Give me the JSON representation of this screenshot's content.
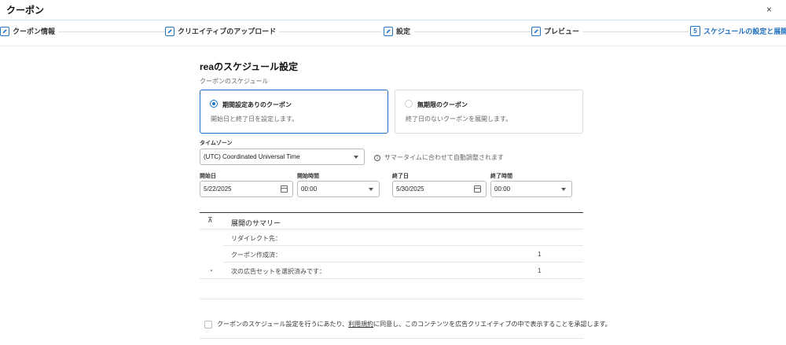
{
  "window": {
    "title": "クーポン",
    "close": "×"
  },
  "steps": [
    {
      "label": "クーポン情報",
      "state": "done"
    },
    {
      "label": "クリエイティブのアップロード",
      "state": "done"
    },
    {
      "label": "設定",
      "state": "done"
    },
    {
      "label": "プレビュー",
      "state": "done"
    },
    {
      "number": "5",
      "label": "スケジュールの設定と展開",
      "state": "active"
    }
  ],
  "main": {
    "heading": "reaのスケジュール設定",
    "subheading": "クーポンのスケジュール",
    "options": [
      {
        "title": "期間設定ありのクーポン",
        "description": "開始日と終了日を設定します。",
        "selected": true
      },
      {
        "title": "無期限のクーポン",
        "description": "終了日のないクーポンを展開します。",
        "selected": false
      }
    ],
    "timezone": {
      "label": "タイムゾーン",
      "value": "(UTC) Coordinated Universal Time",
      "note": "サマータイムに合わせて自動調整されます"
    },
    "start_date": {
      "label": "開始日",
      "value": "5/22/2025"
    },
    "start_time": {
      "label": "開始時間",
      "value": "00:00"
    },
    "end_date": {
      "label": "終了日",
      "value": "5/30/2025"
    },
    "end_time": {
      "label": "終了時間",
      "value": "00:00"
    }
  },
  "summary": {
    "title": "展開のサマリー",
    "rows": [
      {
        "label": "リダイレクト先：",
        "value": ""
      },
      {
        "label": "クーポン作成済：",
        "value": "1"
      },
      {
        "label": "次の広告セットを選択済みです：",
        "value": "1"
      }
    ]
  },
  "consent": {
    "before": "クーポンのスケジュール設定を行うにあたり、",
    "link": "利用規約",
    "after": "に同意し、このコンテンツを広告クリエイティブの中で表示することを承認します。"
  },
  "colors": {
    "accent": "#1f6fc1",
    "border": "#bbbbbb"
  }
}
